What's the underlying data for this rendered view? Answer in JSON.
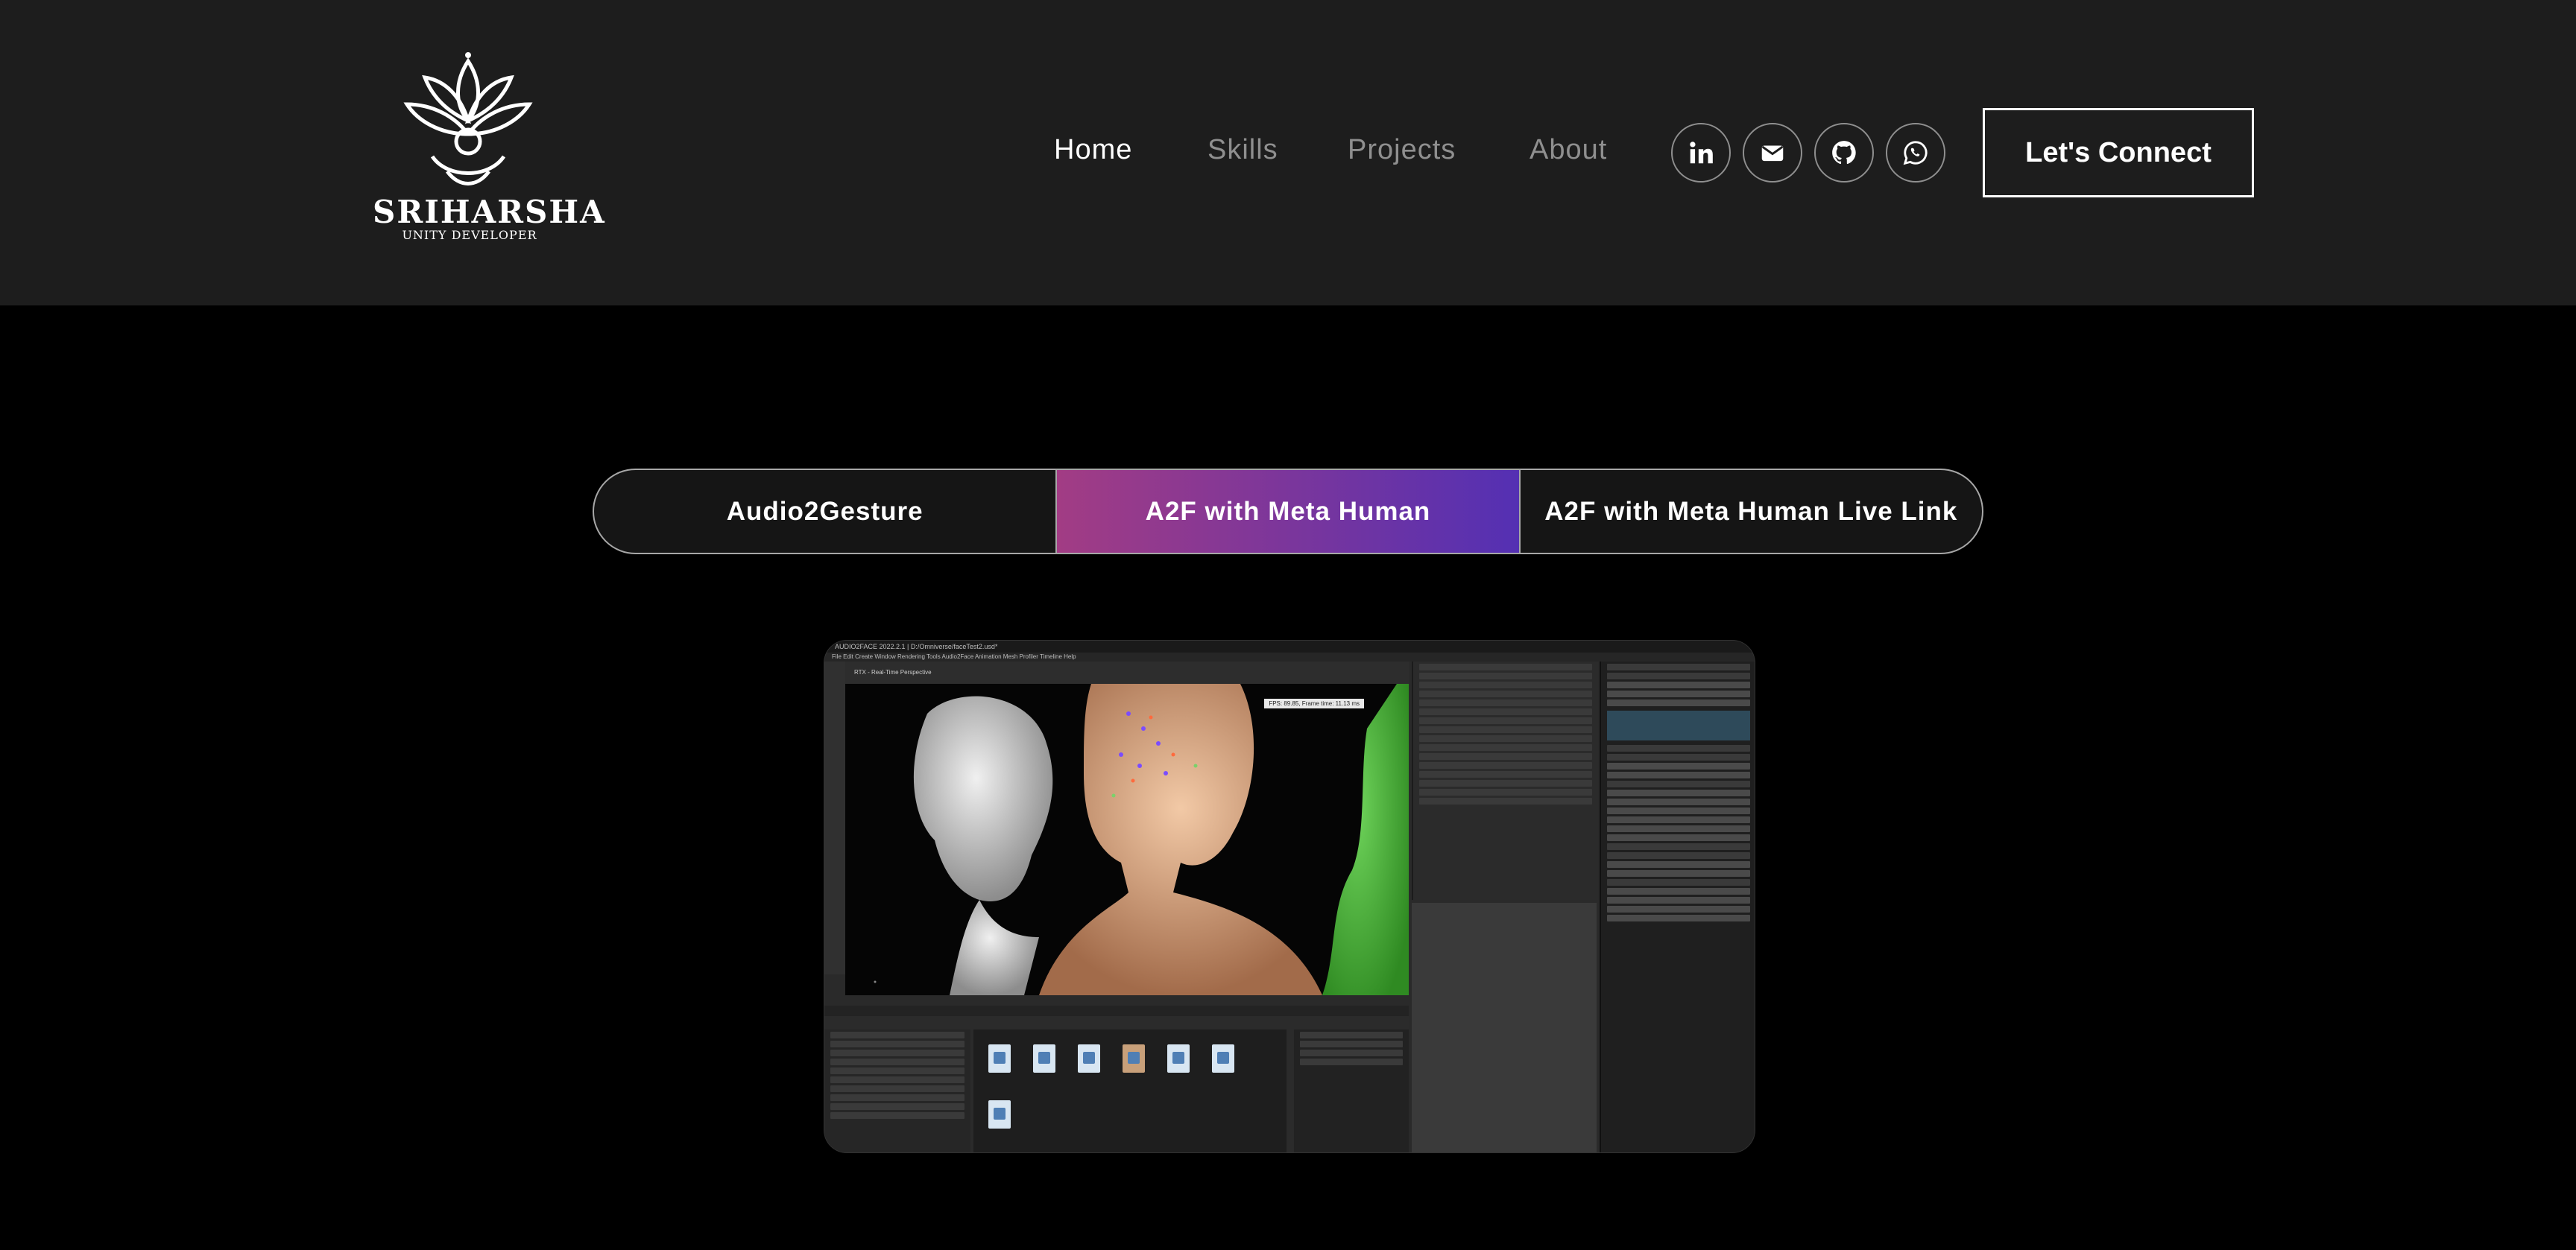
{
  "brand": {
    "name": "SRIHARSHA",
    "subtitle": "UNITY DEVELOPER"
  },
  "nav": {
    "items": [
      {
        "label": "Home",
        "active": true
      },
      {
        "label": "Skills",
        "active": false
      },
      {
        "label": "Projects",
        "active": false
      },
      {
        "label": "About",
        "active": false
      }
    ]
  },
  "social": [
    {
      "icon": "linkedin-icon"
    },
    {
      "icon": "mail-icon"
    },
    {
      "icon": "github-icon"
    },
    {
      "icon": "whatsapp-icon"
    }
  ],
  "cta": {
    "label": "Let's Connect"
  },
  "tabs": [
    {
      "label": "Audio2Gesture",
      "active": false
    },
    {
      "label": "A2F with Meta Human",
      "active": true
    },
    {
      "label": "A2F with Meta Human Live Link",
      "active": false
    }
  ],
  "screenshot": {
    "title_bar": "AUDIO2FACE  2022.2.1  |  D:/Omniverse/faceTest2.usd*",
    "menu": "File  Edit  Create  Window  Rendering  Tools  Audio2Face  Animation  Mesh  Profiler  Timeline  Help",
    "viewport_bar": "RTX - Real-Time     Perspective",
    "fps": "FPS: 89.85, Frame time: 11.13 ms"
  },
  "colors": {
    "header_bg": "#1d1d1d",
    "page_bg": "#000000",
    "tab_gradient_start": "#a23c84",
    "tab_gradient_end": "#5430b3",
    "nav_inactive": "#8f8f8f"
  }
}
